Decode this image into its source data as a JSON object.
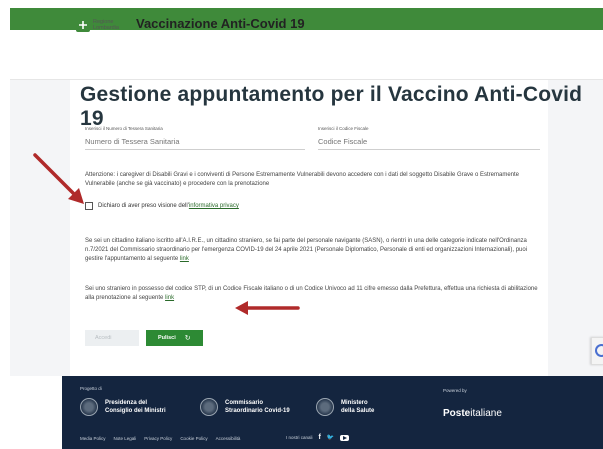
{
  "header": {
    "logo_line1": "Regione",
    "logo_line2": "Lombardia",
    "app_title": "Vaccinazione Anti-Covid 19"
  },
  "main": {
    "page_title": "Gestione appuntamento per il Vaccino Anti-Covid 19",
    "tessera_label": "Inserisci il Numero di Tessera Sanitaria",
    "tessera_placeholder": "Numero di Tessera Sanitaria",
    "cf_label": "Inserisci il Codice Fiscale",
    "cf_placeholder": "Codice Fiscale",
    "notice": "Attenzione: i caregiver di Disabili Gravi e i conviventi di Persone Estremamente Vulnerabili devono accedere con i dati del soggetto Disabile Grave o Estremamente Vulnerabile (anche se già vaccinato) e procedere con la prenotazione",
    "checkbox_text": "Dichiaro di aver preso visione dell'",
    "checkbox_link": "informativa privacy",
    "para1_text": "Se sei un cittadino italiano iscritto all'A.I.R.E., un cittadino straniero, se fai parte del personale navigante (SASN), o rientri in una delle categorie indicate nell'Ordinanza n.7/2021 del Commissario straordinario per l'emergenza COVID-19 del 24 aprile 2021 (Personale Diplomatico, Personale di enti ed organizzazioni Internazionali), puoi gestire l'appuntamento al seguente ",
    "para1_link": "link",
    "para2_text": "Sei uno straniero in possesso del codice STP, di un Codice Fiscale italiano o di un Codice Univoco ad 11 cifre emesso dalla Prefettura, effettua una richiesta di abilitazione alla prenotazione al seguente ",
    "para2_link": "link",
    "btn_login": "Accedi",
    "btn_clear": "Pulisci",
    "refresh_icon": "↻"
  },
  "footer": {
    "project_label": "Progetto di",
    "partner1_line1": "Presidenza del",
    "partner1_line2": "Consiglio dei Ministri",
    "partner2_line1": "Commissario",
    "partner2_line2": "Straordinario Covid-19",
    "partner3_line1": "Ministero",
    "partner3_line2": "della Salute",
    "powered_label": "Powered by",
    "poste_bold": "Poste",
    "poste_rest": "italiane",
    "links": [
      "Media Policy",
      "Note Legali",
      "Privacy Policy",
      "Cookie Policy",
      "Accessibilità"
    ],
    "channels_label": "I nostri canali",
    "facebook_glyph": "f",
    "twitter_glyph": "🐦"
  },
  "colors": {
    "brand_green": "#3f8a3a",
    "button_green": "#2d8a34",
    "footer_navy": "#14253f",
    "arrow_red": "#b02a2a"
  },
  "icons": [
    "refresh-icon",
    "facebook-icon",
    "twitter-icon",
    "youtube-icon",
    "arrow-annotation-icon"
  ]
}
